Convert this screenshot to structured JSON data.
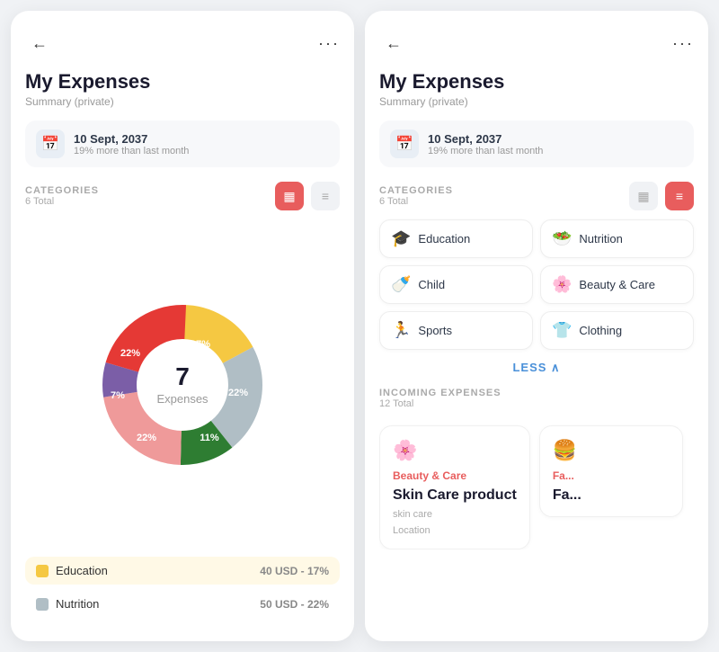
{
  "left": {
    "back_label": "←",
    "more_label": "···",
    "title": "My Expenses",
    "subtitle": "Summary (private)",
    "date": "10 Sept, 2037",
    "date_sub": "19% more than last month",
    "categories_label": "CATEGORIES",
    "categories_total": "6 Total",
    "donut_number": "7",
    "donut_label": "Expenses",
    "segments": [
      {
        "color": "#f5c842",
        "pct": 17,
        "label": "17%"
      },
      {
        "color": "#b0bec5",
        "pct": 22,
        "label": "22%"
      },
      {
        "color": "#2e7d32",
        "pct": 11,
        "label": "11%"
      },
      {
        "color": "#ef9a9a",
        "pct": 22,
        "label": "22%"
      },
      {
        "color": "#7b5ea7",
        "pct": 7,
        "label": "7%"
      },
      {
        "color": "#e53935",
        "pct": 22,
        "label": "22%"
      }
    ],
    "legend": [
      {
        "color": "#f5c842",
        "name": "Education",
        "value": "40 USD - 17%"
      },
      {
        "color": "#b0bec5",
        "name": "Nutrition",
        "value": "50 USD - 22%"
      }
    ]
  },
  "right": {
    "back_label": "←",
    "more_label": "···",
    "title": "My Expenses",
    "subtitle": "Summary (private)",
    "date": "10 Sept, 2037",
    "date_sub": "19% more than last month",
    "categories_label": "CATEGORIES",
    "categories_total": "6 Total",
    "categories": [
      {
        "icon": "🎓",
        "name": "Education"
      },
      {
        "icon": "🥗",
        "name": "Nutrition"
      },
      {
        "icon": "🍼",
        "name": "Child"
      },
      {
        "icon": "🌸",
        "name": "Beauty & Care"
      },
      {
        "icon": "🏃",
        "name": "Sports"
      },
      {
        "icon": "👕",
        "name": "Clothing"
      }
    ],
    "less_label": "LESS ∧",
    "incoming_label": "INCOMING EXPENSES",
    "incoming_total": "12 Total",
    "incoming_cards": [
      {
        "icon": "🌸",
        "category": "Beauty & Care",
        "title": "Skin Care product",
        "sub": "skin care",
        "location_label": "Location"
      },
      {
        "icon": "🍔",
        "category": "Fa...",
        "title": "Fa...",
        "sub": "",
        "location_label": ""
      }
    ]
  }
}
